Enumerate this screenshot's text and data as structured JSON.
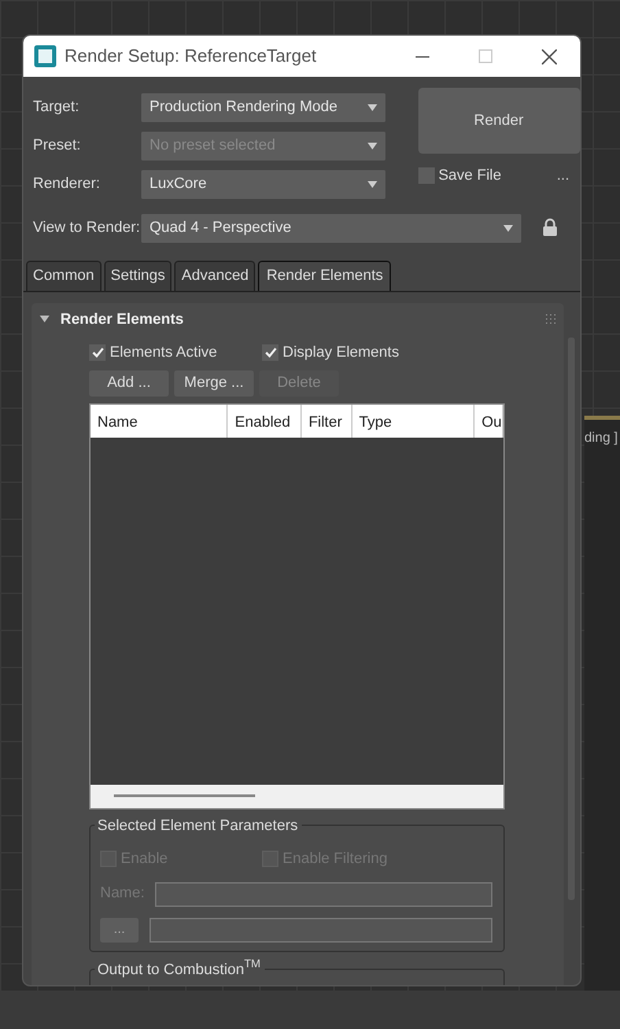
{
  "window": {
    "title": "Render Setup: ReferenceTarget"
  },
  "viewport": {
    "label": "ding ]"
  },
  "fields": [
    {
      "label": "Target:",
      "value": "Production Rendering Mode",
      "disabled": false
    },
    {
      "label": "Preset:",
      "value": "No preset selected",
      "disabled": true
    },
    {
      "label": "Renderer:",
      "value": "LuxCore",
      "disabled": false
    }
  ],
  "render_button": "Render",
  "save_file": {
    "label": "Save File",
    "checked": false
  },
  "more_button": "...",
  "view_to_render": {
    "label": "View to Render:",
    "value": "Quad 4 - Perspective",
    "locked": true
  },
  "tabs": [
    {
      "label": "Common",
      "selected": false
    },
    {
      "label": "Settings",
      "selected": false
    },
    {
      "label": "Advanced",
      "selected": false
    },
    {
      "label": "Render Elements",
      "selected": true
    }
  ],
  "rollout": {
    "title": "Render Elements",
    "expanded": true,
    "options": [
      {
        "label": "Elements Active",
        "checked": true
      },
      {
        "label": "Display Elements",
        "checked": true
      }
    ],
    "buttons": [
      {
        "label": "Add ...",
        "disabled": false
      },
      {
        "label": "Merge ...",
        "disabled": false
      },
      {
        "label": "Delete",
        "disabled": true
      }
    ],
    "table": {
      "columns": [
        "Name",
        "Enabled",
        "Filter",
        "Type",
        "Ou"
      ]
    },
    "selected_params": {
      "title": "Selected Element Parameters",
      "options": [
        {
          "label": "Enable",
          "checked": false,
          "disabled": true
        },
        {
          "label": "Enable Filtering",
          "checked": false,
          "disabled": true
        }
      ],
      "name_label": "Name:",
      "browse_button": "..."
    },
    "output_group": {
      "title": "Output to Combustion$^{TM}$"
    }
  }
}
